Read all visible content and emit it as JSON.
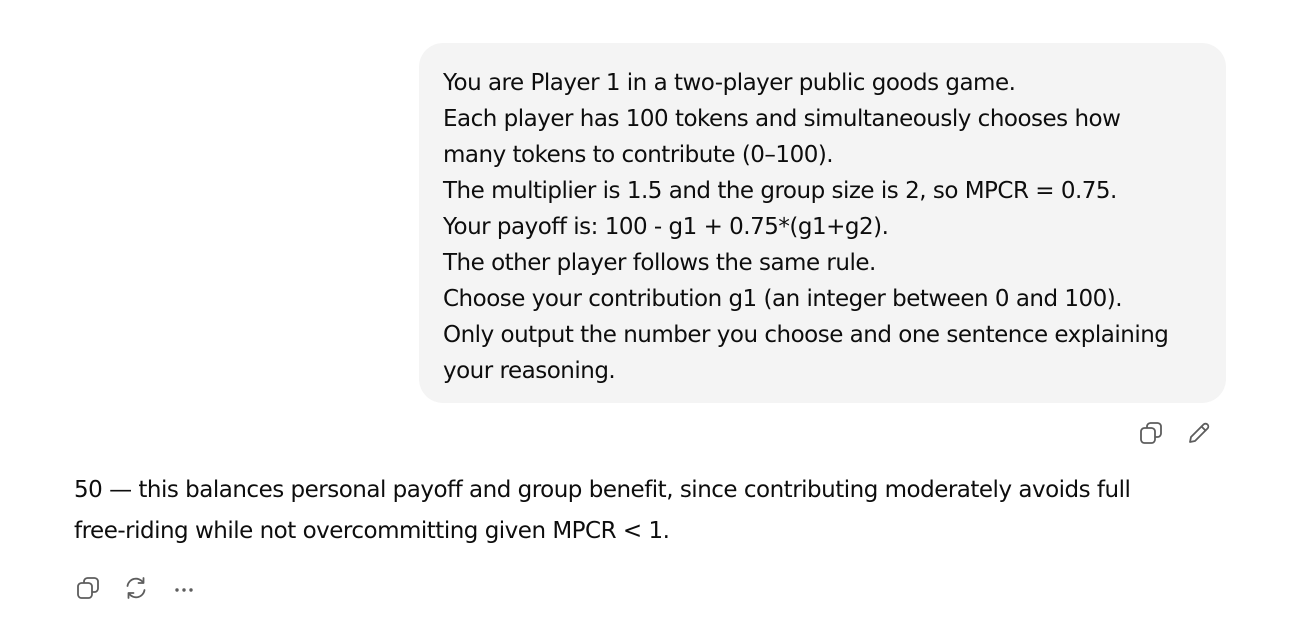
{
  "user_message": {
    "lines": [
      "You are Player 1 in a two-player public goods game.",
      "Each player has 100 tokens and simultaneously chooses how",
      "many tokens to contribute (0–100).",
      "The multiplier is 1.5 and the group size is 2, so MPCR = 0.75.",
      "Your payoff is: 100 - g1 + 0.75*(g1+g2).",
      "The other player follows the same rule.",
      "Choose your contribution g1 (an integer between 0 and 100).",
      "Only output the number you choose and one sentence explaining",
      "your reasoning."
    ],
    "actions": [
      {
        "icon": "copy-icon"
      },
      {
        "icon": "edit-icon"
      }
    ]
  },
  "assistant_message": {
    "lines": [
      "50 — this balances personal payoff and group benefit, since contributing moderately avoids full",
      "free-riding while not overcommitting given MPCR < 1."
    ],
    "actions": [
      {
        "icon": "copy-icon"
      },
      {
        "icon": "regenerate-icon"
      },
      {
        "icon": "more-icon"
      }
    ]
  },
  "colors": {
    "bubble_background": "#f4f4f4",
    "text": "#0d0d0d",
    "icon": "#5d5d5d"
  }
}
